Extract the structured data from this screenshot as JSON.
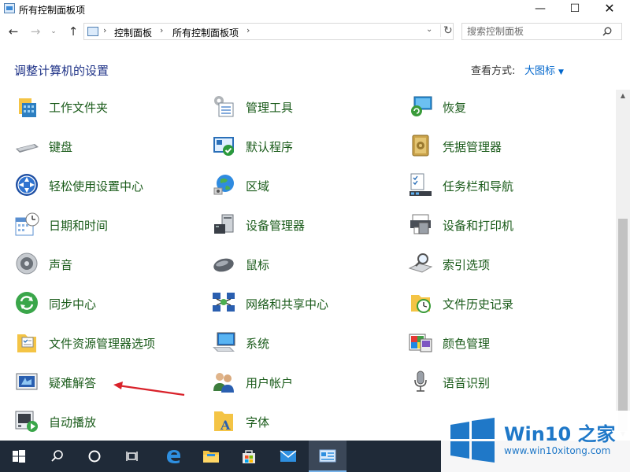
{
  "window": {
    "title": "所有控制面板项",
    "minimize_glyph": "—",
    "maximize_glyph": "☐",
    "close_glyph": "✕"
  },
  "nav": {
    "back_glyph": "←",
    "forward_glyph": "→",
    "recent_glyph": "⌄",
    "up_glyph": "↑"
  },
  "address": {
    "crumbs": [
      "控制面板",
      "所有控制面板项"
    ],
    "separator": "›",
    "dropdown_glyph": "⌄",
    "refresh_glyph": "↻"
  },
  "search": {
    "placeholder": "搜索控制面板",
    "value": ""
  },
  "header": {
    "title": "调整计算机的设置",
    "view_by_label": "查看方式:",
    "view_by_value": "大图标"
  },
  "items": [
    {
      "label": "工作文件夹",
      "icon": "work-folders-icon"
    },
    {
      "label": "管理工具",
      "icon": "admin-tools-icon"
    },
    {
      "label": "恢复",
      "icon": "recovery-icon"
    },
    {
      "label": "键盘",
      "icon": "keyboard-icon"
    },
    {
      "label": "默认程序",
      "icon": "default-programs-icon"
    },
    {
      "label": "凭据管理器",
      "icon": "credential-manager-icon"
    },
    {
      "label": "轻松使用设置中心",
      "icon": "ease-of-access-icon"
    },
    {
      "label": "区域",
      "icon": "region-icon"
    },
    {
      "label": "任务栏和导航",
      "icon": "taskbar-navigation-icon"
    },
    {
      "label": "日期和时间",
      "icon": "date-time-icon"
    },
    {
      "label": "设备管理器",
      "icon": "device-manager-icon"
    },
    {
      "label": "设备和打印机",
      "icon": "devices-printers-icon"
    },
    {
      "label": "声音",
      "icon": "sound-icon"
    },
    {
      "label": "鼠标",
      "icon": "mouse-icon"
    },
    {
      "label": "索引选项",
      "icon": "indexing-options-icon"
    },
    {
      "label": "同步中心",
      "icon": "sync-center-icon"
    },
    {
      "label": "网络和共享中心",
      "icon": "network-sharing-icon"
    },
    {
      "label": "文件历史记录",
      "icon": "file-history-icon"
    },
    {
      "label": "文件资源管理器选项",
      "icon": "explorer-options-icon"
    },
    {
      "label": "系统",
      "icon": "system-icon"
    },
    {
      "label": "颜色管理",
      "icon": "color-management-icon"
    },
    {
      "label": "疑难解答",
      "icon": "troubleshooting-icon"
    },
    {
      "label": "用户帐户",
      "icon": "user-accounts-icon"
    },
    {
      "label": "语音识别",
      "icon": "speech-recognition-icon"
    },
    {
      "label": "自动播放",
      "icon": "autoplay-icon"
    },
    {
      "label": "字体",
      "icon": "fonts-icon"
    }
  ],
  "taskbar": {
    "buttons": [
      "start",
      "search",
      "cortana",
      "task-view",
      "edge",
      "file-explorer",
      "store",
      "mail",
      "control-panel"
    ],
    "active": "control-panel"
  },
  "watermark": {
    "title": "Win10 之家",
    "url": "www.win10xitong.com"
  },
  "colors": {
    "link_green": "#1a5b1a",
    "heading_blue": "#1e3287",
    "accent_blue": "#0066cc",
    "taskbar": "#1f2a38",
    "annotation_red": "#d9222a"
  }
}
